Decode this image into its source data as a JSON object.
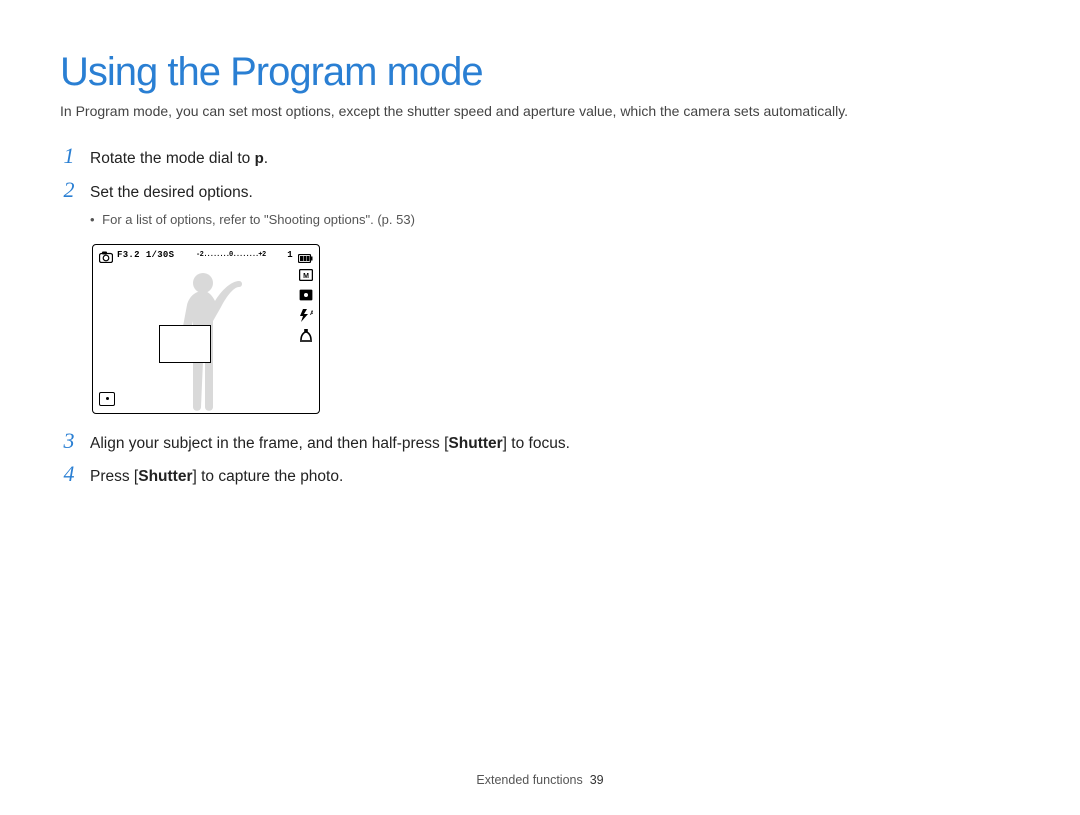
{
  "title": "Using the Program mode",
  "intro": "In Program mode, you can set most options, except the shutter speed and aperture value, which the camera sets automatically.",
  "steps": {
    "s1": {
      "num": "1",
      "text_a": "Rotate the mode dial to ",
      "mode_glyph": "p",
      "text_b": "."
    },
    "s2": {
      "num": "2",
      "text": "Set the desired options.",
      "bullet": "For a list of options, refer to \"Shooting options\". (p. 53)"
    },
    "s3": {
      "num": "3",
      "text_a": "Align your subject in the frame, and then half-press [",
      "bold": "Shutter",
      "text_b": "] to focus."
    },
    "s4": {
      "num": "4",
      "text_a": "Press [",
      "bold": "Shutter",
      "text_b": "] to capture the photo."
    }
  },
  "lcd": {
    "top": {
      "f": "F3.2",
      "shutter": "1/30S",
      "ev": "-2 ........ 0 ........ +2",
      "count": "1"
    },
    "icons": {
      "cam": "camera-icon",
      "battery": "battery-icon",
      "r1": "resolution-icon",
      "r2": "metering-icon",
      "r3": "flash-auto-icon",
      "r4": "ois-icon",
      "bl": "single-shot-icon",
      "focus_rect": "focus-rectangle",
      "subject": "human-silhouette"
    }
  },
  "footer": {
    "section": "Extended functions",
    "page": "39"
  }
}
